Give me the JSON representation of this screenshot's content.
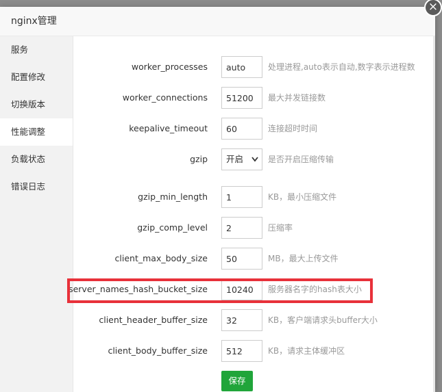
{
  "modal": {
    "title": "nginx管理",
    "close_glyph": "×"
  },
  "sidebar": {
    "items": [
      {
        "label": "服务"
      },
      {
        "label": "配置修改"
      },
      {
        "label": "切换版本"
      },
      {
        "label": "性能调整",
        "active": true
      },
      {
        "label": "负载状态"
      },
      {
        "label": "错误日志"
      }
    ]
  },
  "form": {
    "fields": [
      {
        "label": "worker_processes",
        "value": "auto",
        "help": "处理进程,auto表示自动,数字表示进程数"
      },
      {
        "label": "worker_connections",
        "value": "51200",
        "help": "最大并发链接数"
      },
      {
        "label": "keepalive_timeout",
        "value": "60",
        "help": "连接超时时间"
      },
      {
        "label": "gzip",
        "value": "开启",
        "help": "是否开启压缩传输",
        "type": "select"
      },
      {
        "label": "gzip_min_length",
        "value": "1",
        "help": "KB，最小压缩文件"
      },
      {
        "label": "gzip_comp_level",
        "value": "2",
        "help": "压缩率"
      },
      {
        "label": "client_max_body_size",
        "value": "50",
        "help": "MB，最大上传文件"
      },
      {
        "label": "server_names_hash_bucket_size",
        "value": "10240",
        "help": "服务器名字的hash表大小",
        "highlighted": true
      },
      {
        "label": "client_header_buffer_size",
        "value": "32",
        "help": "KB，客户端请求头buffer大小"
      },
      {
        "label": "client_body_buffer_size",
        "value": "512",
        "help": "KB，请求主体缓冲区"
      }
    ],
    "save_label": "保存"
  },
  "colors": {
    "accent_green": "#20a53a",
    "highlight_red": "#e8313a"
  }
}
